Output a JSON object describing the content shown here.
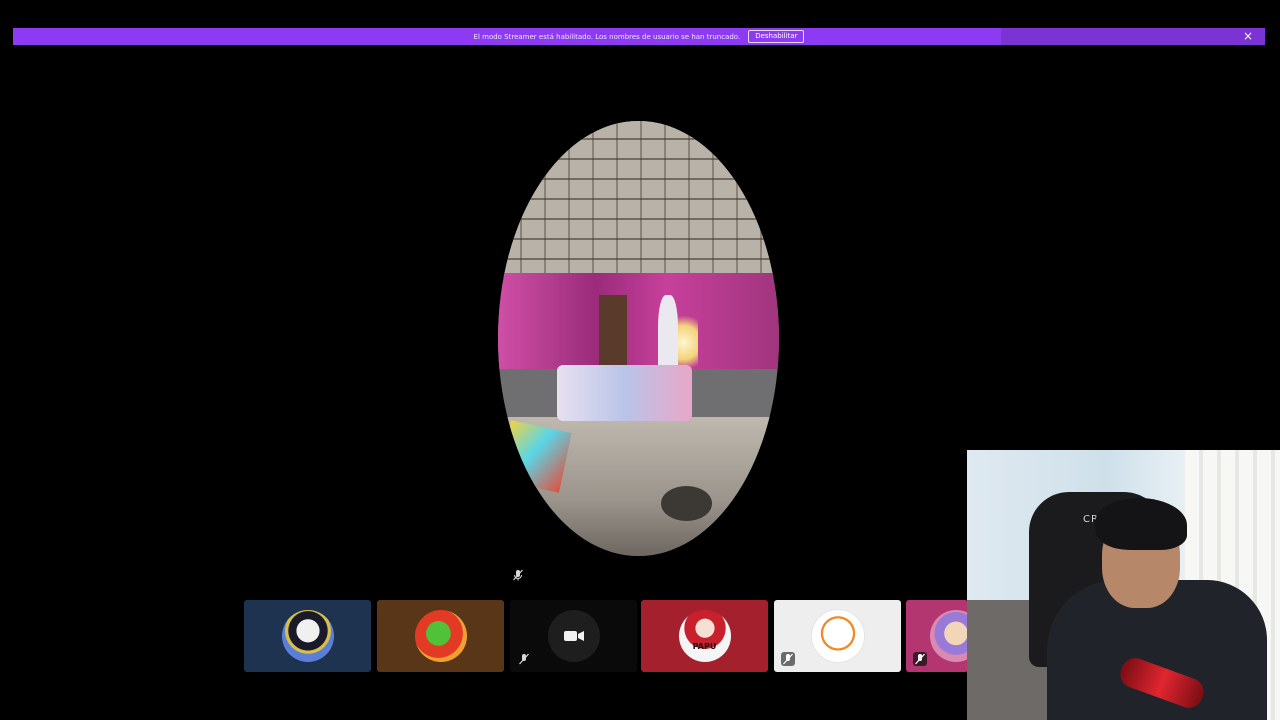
{
  "banner": {
    "message": "El modo Streamer está habilitado. Los nombres de usuario se han truncado.",
    "disable_label": "Deshabilitar",
    "close_glyph": "×",
    "color": "#8c3bf2"
  },
  "main_video": {
    "muted_icon": "mic-muted-icon"
  },
  "participants": [
    {
      "avatar": "penguin-avatar",
      "tile_color": "#1e3350",
      "muted": false
    },
    {
      "avatar": "parrot-avatar",
      "tile_color": "#5a3618",
      "muted": false
    },
    {
      "avatar": "camera-avatar",
      "tile_color": "#0a0a0a",
      "muted": true
    },
    {
      "avatar": "papu-anime-avatar",
      "avatar_text": "PAPU",
      "tile_color": "#a3202c",
      "muted": false
    },
    {
      "avatar": "bugs-bunny-avatar",
      "tile_color": "#eeeeee",
      "muted": true
    },
    {
      "avatar": "pink-avatar",
      "tile_color": "#b33670",
      "muted": true
    }
  ],
  "facecam": {
    "chair_text": "CRE"
  }
}
